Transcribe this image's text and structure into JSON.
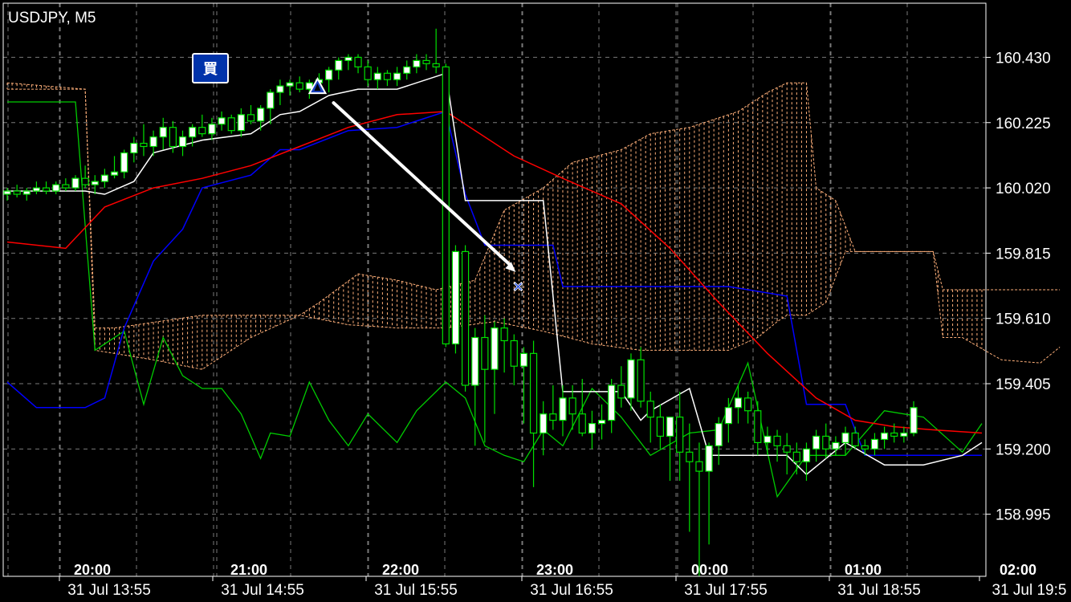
{
  "header": {
    "symbol": "USDJPY, M5"
  },
  "order_marker": {
    "label": "買"
  },
  "colors": {
    "background": "#000000",
    "frame": "#ffffff",
    "grid": "#7a7a7a",
    "bull_body": "#ffffff",
    "bear_body": "#000000",
    "wick": "#00e000",
    "candle_outline": "#00e000",
    "tenkan": "#ffffff",
    "kijun": "#0000ff",
    "ma": "#ff0000",
    "chikou": "#00cc00",
    "cloud": "#ffb07a",
    "order_badge": "#0033aa",
    "arrow": "#ffffff"
  },
  "chart_data": {
    "type": "candlestick",
    "ylim": [
      158.8,
      160.6
    ],
    "x_count": 100,
    "price_ticks": [
      "160.430",
      "160.225",
      "160.020",
      "159.815",
      "159.610",
      "159.405",
      "159.200",
      "158.995"
    ],
    "time_labels_top": [
      "20:00",
      "21:00",
      "22:00",
      "23:00",
      "00:00",
      "01:00",
      "02:00"
    ],
    "time_labels_bottom": [
      "31 Jul 13:55",
      "31 Jul 14:55",
      "31 Jul 15:55",
      "31 Jul 16:55",
      "31 Jul 17:55",
      "31 Jul 18:55",
      "31 Jul 19:5"
    ],
    "candles": [
      [
        160.0,
        160.02,
        159.98,
        160.01
      ],
      [
        160.01,
        160.03,
        159.99,
        160.0
      ],
      [
        160.0,
        160.02,
        159.98,
        160.01
      ],
      [
        160.01,
        160.04,
        160.0,
        160.02
      ],
      [
        160.02,
        160.04,
        160.0,
        160.01
      ],
      [
        160.01,
        160.04,
        160.0,
        160.03
      ],
      [
        160.03,
        160.05,
        160.01,
        160.02
      ],
      [
        160.02,
        160.06,
        160.01,
        160.05
      ],
      [
        160.05,
        160.09,
        160.02,
        160.03
      ],
      [
        160.03,
        160.06,
        160.0,
        160.04
      ],
      [
        160.04,
        160.08,
        160.02,
        160.06
      ],
      [
        160.06,
        160.12,
        160.05,
        160.07
      ],
      [
        160.07,
        160.14,
        160.05,
        160.13
      ],
      [
        160.13,
        160.18,
        160.1,
        160.16
      ],
      [
        160.16,
        160.22,
        160.12,
        160.15
      ],
      [
        160.15,
        160.2,
        160.12,
        160.18
      ],
      [
        160.18,
        160.24,
        160.14,
        160.21
      ],
      [
        160.21,
        160.23,
        160.13,
        160.15
      ],
      [
        160.15,
        160.2,
        160.12,
        160.18
      ],
      [
        160.18,
        160.22,
        160.15,
        160.21
      ],
      [
        160.21,
        160.25,
        160.18,
        160.19
      ],
      [
        160.19,
        160.24,
        160.17,
        160.22
      ],
      [
        160.22,
        160.26,
        160.2,
        160.24
      ],
      [
        160.24,
        160.25,
        160.19,
        160.2
      ],
      [
        160.2,
        160.27,
        160.18,
        160.25
      ],
      [
        160.25,
        160.28,
        160.22,
        160.23
      ],
      [
        160.23,
        160.28,
        160.2,
        160.27
      ],
      [
        160.27,
        160.33,
        160.22,
        160.32
      ],
      [
        160.32,
        160.36,
        160.28,
        160.34
      ],
      [
        160.34,
        160.36,
        160.31,
        160.35
      ],
      [
        160.35,
        160.37,
        160.32,
        160.33
      ],
      [
        160.33,
        160.36,
        160.3,
        160.35
      ],
      [
        160.35,
        160.38,
        160.33,
        160.36
      ],
      [
        160.36,
        160.4,
        160.32,
        160.39
      ],
      [
        160.39,
        160.43,
        160.36,
        160.42
      ],
      [
        160.42,
        160.44,
        160.39,
        160.43
      ],
      [
        160.43,
        160.44,
        160.38,
        160.4
      ],
      [
        160.4,
        160.42,
        160.34,
        160.36
      ],
      [
        160.36,
        160.4,
        160.33,
        160.38
      ],
      [
        160.38,
        160.39,
        160.34,
        160.36
      ],
      [
        160.36,
        160.4,
        160.34,
        160.38
      ],
      [
        160.38,
        160.42,
        160.36,
        160.4
      ],
      [
        160.4,
        160.44,
        160.38,
        160.42
      ],
      [
        160.42,
        160.44,
        160.39,
        160.41
      ],
      [
        160.41,
        160.52,
        160.38,
        160.4
      ],
      [
        160.4,
        160.41,
        159.52,
        159.53
      ],
      [
        159.53,
        159.84,
        159.5,
        159.82
      ],
      [
        159.82,
        159.84,
        159.38,
        159.4
      ],
      [
        159.4,
        159.58,
        159.21,
        159.55
      ],
      [
        159.55,
        159.62,
        159.22,
        159.45
      ],
      [
        159.45,
        159.6,
        159.31,
        159.58
      ],
      [
        159.58,
        159.61,
        159.44,
        159.54
      ],
      [
        159.54,
        159.56,
        159.4,
        159.46
      ],
      [
        159.46,
        159.52,
        159.28,
        159.5
      ],
      [
        159.5,
        159.54,
        159.08,
        159.25
      ],
      [
        159.25,
        159.35,
        159.18,
        159.31
      ],
      [
        159.31,
        159.4,
        159.26,
        159.29
      ],
      [
        159.29,
        159.4,
        159.24,
        159.36
      ],
      [
        159.36,
        159.4,
        159.26,
        159.31
      ],
      [
        159.31,
        159.42,
        159.24,
        159.25
      ],
      [
        159.25,
        159.32,
        159.2,
        159.28
      ],
      [
        159.28,
        159.34,
        159.23,
        159.29
      ],
      [
        159.29,
        159.42,
        159.25,
        159.4
      ],
      [
        159.4,
        159.46,
        159.33,
        159.36
      ],
      [
        159.36,
        159.5,
        159.32,
        159.48
      ],
      [
        159.48,
        159.52,
        159.33,
        159.35
      ],
      [
        159.35,
        159.38,
        159.22,
        159.3
      ],
      [
        159.3,
        159.34,
        159.2,
        159.24
      ],
      [
        159.24,
        159.3,
        159.1,
        159.3
      ],
      [
        159.3,
        159.38,
        159.1,
        159.19
      ],
      [
        159.19,
        159.28,
        158.94,
        159.16
      ],
      [
        159.16,
        159.22,
        158.8,
        159.13
      ],
      [
        159.13,
        159.22,
        158.9,
        159.21
      ],
      [
        159.21,
        159.3,
        159.15,
        159.28
      ],
      [
        159.28,
        159.36,
        159.22,
        159.33
      ],
      [
        159.33,
        159.4,
        159.28,
        159.36
      ],
      [
        159.36,
        159.38,
        159.28,
        159.32
      ],
      [
        159.32,
        159.35,
        159.18,
        159.22
      ],
      [
        159.22,
        159.27,
        159.18,
        159.24
      ],
      [
        159.24,
        159.26,
        159.16,
        159.21
      ],
      [
        159.21,
        159.25,
        159.12,
        159.19
      ],
      [
        159.19,
        159.22,
        159.12,
        159.16
      ],
      [
        159.16,
        159.22,
        159.1,
        159.2
      ],
      [
        159.2,
        159.26,
        159.16,
        159.24
      ],
      [
        159.24,
        159.28,
        159.17,
        159.2
      ],
      [
        159.2,
        159.24,
        159.18,
        159.22
      ],
      [
        159.22,
        159.27,
        159.18,
        159.25
      ],
      [
        159.25,
        159.27,
        159.2,
        159.21
      ],
      [
        159.21,
        159.23,
        159.18,
        159.2
      ],
      [
        159.2,
        159.25,
        159.18,
        159.23
      ],
      [
        159.23,
        159.27,
        159.2,
        159.25
      ],
      [
        159.25,
        159.28,
        159.22,
        159.24
      ],
      [
        159.24,
        159.27,
        159.22,
        159.25
      ],
      [
        159.25,
        159.35,
        159.24,
        159.33
      ]
    ],
    "tenkan": [
      [
        0,
        160.01
      ],
      [
        8,
        160.01
      ],
      [
        10,
        160.0
      ],
      [
        13,
        160.04
      ],
      [
        15,
        160.13
      ],
      [
        20,
        160.17
      ],
      [
        25,
        160.19
      ],
      [
        28,
        160.25
      ],
      [
        30,
        160.26
      ],
      [
        33,
        160.31
      ],
      [
        36,
        160.33
      ],
      [
        40,
        160.33
      ],
      [
        45,
        160.38
      ],
      [
        47,
        159.98
      ],
      [
        55,
        159.98
      ],
      [
        57,
        159.38
      ],
      [
        63,
        159.38
      ],
      [
        65,
        159.29
      ],
      [
        66,
        159.32
      ],
      [
        70,
        159.39
      ],
      [
        72,
        159.18
      ],
      [
        80,
        159.18
      ],
      [
        82,
        159.12
      ],
      [
        86,
        159.22
      ],
      [
        90,
        159.15
      ],
      [
        94,
        159.15
      ],
      [
        98,
        159.18
      ],
      [
        100,
        159.22
      ]
    ],
    "kijun": [
      [
        0,
        159.41
      ],
      [
        3,
        159.33
      ],
      [
        8,
        159.33
      ],
      [
        10,
        159.36
      ],
      [
        12,
        159.58
      ],
      [
        15,
        159.79
      ],
      [
        18,
        159.89
      ],
      [
        20,
        160.02
      ],
      [
        25,
        160.06
      ],
      [
        28,
        160.14
      ],
      [
        30,
        160.14
      ],
      [
        35,
        160.2
      ],
      [
        40,
        160.21
      ],
      [
        45,
        160.26
      ],
      [
        47,
        160.0
      ],
      [
        49,
        159.84
      ],
      [
        56,
        159.84
      ],
      [
        57,
        159.71
      ],
      [
        74,
        159.71
      ],
      [
        80,
        159.68
      ],
      [
        82,
        159.34
      ],
      [
        86,
        159.34
      ],
      [
        88,
        159.18
      ],
      [
        100,
        159.18
      ]
    ],
    "ma": [
      [
        0,
        159.85
      ],
      [
        6,
        159.83
      ],
      [
        10,
        159.96
      ],
      [
        15,
        160.02
      ],
      [
        20,
        160.05
      ],
      [
        25,
        160.09
      ],
      [
        30,
        160.15
      ],
      [
        35,
        160.21
      ],
      [
        40,
        160.25
      ],
      [
        45,
        160.26
      ],
      [
        47,
        160.22
      ],
      [
        52,
        160.12
      ],
      [
        57,
        160.05
      ],
      [
        63,
        159.97
      ],
      [
        68,
        159.83
      ],
      [
        73,
        159.66
      ],
      [
        78,
        159.5
      ],
      [
        83,
        159.36
      ],
      [
        87,
        159.29
      ],
      [
        91,
        159.27
      ],
      [
        95,
        159.26
      ],
      [
        100,
        159.25
      ]
    ],
    "chikou": [
      [
        0,
        160.29
      ],
      [
        7,
        160.29
      ],
      [
        9,
        159.51
      ],
      [
        12,
        159.57
      ],
      [
        14,
        159.34
      ],
      [
        16,
        159.55
      ],
      [
        18,
        159.43
      ],
      [
        20,
        159.39
      ],
      [
        22,
        159.39
      ],
      [
        24,
        159.31
      ],
      [
        26,
        159.17
      ],
      [
        27,
        159.25
      ],
      [
        29,
        159.24
      ],
      [
        31,
        159.41
      ],
      [
        33,
        159.29
      ],
      [
        35,
        159.21
      ],
      [
        37,
        159.31
      ],
      [
        40,
        159.22
      ],
      [
        42,
        159.32
      ],
      [
        45,
        159.41
      ],
      [
        47,
        159.36
      ],
      [
        49,
        159.21
      ],
      [
        51,
        159.18
      ],
      [
        53,
        159.16
      ],
      [
        55,
        159.26
      ],
      [
        57,
        159.21
      ],
      [
        60,
        159.39
      ],
      [
        63,
        159.3
      ],
      [
        66,
        159.18
      ],
      [
        70,
        159.25
      ],
      [
        73,
        159.26
      ],
      [
        76,
        159.47
      ],
      [
        79,
        159.05
      ],
      [
        82,
        159.18
      ],
      [
        86,
        159.18
      ],
      [
        90,
        159.32
      ],
      [
        94,
        159.3
      ],
      [
        98,
        159.19
      ],
      [
        100,
        159.28
      ]
    ],
    "cloud_top": [
      [
        0,
        160.35
      ],
      [
        8,
        160.33
      ],
      [
        9,
        159.58
      ],
      [
        11,
        159.58
      ],
      [
        20,
        159.62
      ],
      [
        30,
        159.62
      ],
      [
        32,
        159.66
      ],
      [
        36,
        159.75
      ],
      [
        40,
        159.73
      ],
      [
        44,
        159.7
      ],
      [
        48,
        159.73
      ],
      [
        51,
        159.95
      ],
      [
        55,
        160.02
      ],
      [
        58,
        160.1
      ],
      [
        63,
        160.14
      ],
      [
        66,
        160.19
      ],
      [
        70,
        160.21
      ],
      [
        75,
        160.26
      ],
      [
        78,
        160.32
      ],
      [
        80,
        160.35
      ],
      [
        82,
        160.35
      ],
      [
        83,
        160.02
      ],
      [
        85,
        159.98
      ],
      [
        87,
        159.82
      ],
      [
        95,
        159.82
      ],
      [
        96,
        159.7
      ],
      [
        108,
        159.7
      ]
    ],
    "cloud_bottom": [
      [
        0,
        160.33
      ],
      [
        8,
        160.33
      ],
      [
        9,
        159.51
      ],
      [
        15,
        159.48
      ],
      [
        20,
        159.45
      ],
      [
        25,
        159.55
      ],
      [
        30,
        159.62
      ],
      [
        35,
        159.59
      ],
      [
        40,
        159.58
      ],
      [
        45,
        159.58
      ],
      [
        50,
        159.6
      ],
      [
        55,
        159.57
      ],
      [
        60,
        159.53
      ],
      [
        65,
        159.51
      ],
      [
        70,
        159.51
      ],
      [
        74,
        159.51
      ],
      [
        77,
        159.55
      ],
      [
        79,
        159.6
      ],
      [
        80,
        159.62
      ],
      [
        82,
        159.62
      ],
      [
        84,
        159.66
      ],
      [
        86,
        159.82
      ],
      [
        95,
        159.82
      ],
      [
        96,
        159.55
      ],
      [
        98,
        159.55
      ],
      [
        102,
        159.48
      ],
      [
        106,
        159.47
      ],
      [
        108,
        159.52
      ]
    ],
    "order": {
      "entry_index": 32,
      "entry_price": 160.33,
      "exit_index": 53,
      "exit_price": 159.71
    }
  }
}
